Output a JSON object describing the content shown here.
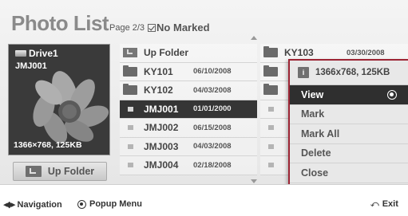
{
  "header": {
    "title": "Photo List",
    "page_label": "Page 2/3",
    "mark_status": "No Marked"
  },
  "preview": {
    "drive_label": "Drive1",
    "filename": "JMJ001",
    "resolution": "1366×768, 125KB",
    "up_folder_label": "Up Folder"
  },
  "files_col1": [
    {
      "name": "Up Folder",
      "date": "",
      "type": "up"
    },
    {
      "name": "KY101",
      "date": "06/10/2008",
      "type": "folder"
    },
    {
      "name": "KY102",
      "date": "04/03/2008",
      "type": "folder"
    },
    {
      "name": "JMJ001",
      "date": "01/01/2000",
      "type": "photo"
    },
    {
      "name": "JMJ002",
      "date": "06/15/2008",
      "type": "photo"
    },
    {
      "name": "JMJ003",
      "date": "04/03/2008",
      "type": "photo"
    },
    {
      "name": "JMJ004",
      "date": "02/18/2008",
      "type": "photo"
    }
  ],
  "files_col2": [
    {
      "name": "KY103",
      "date": "03/30/2008",
      "type": "folder"
    }
  ],
  "popup": {
    "info": "1366x768, 125KB",
    "items": [
      "View",
      "Mark",
      "Mark All",
      "Delete",
      "Close"
    ],
    "selected_index": 0
  },
  "help": {
    "navigation": "Navigation",
    "popup_menu": "Popup Menu",
    "exit": "Exit"
  },
  "colors": {
    "popup_border": "#9c2434",
    "selected_row": "#353535"
  }
}
